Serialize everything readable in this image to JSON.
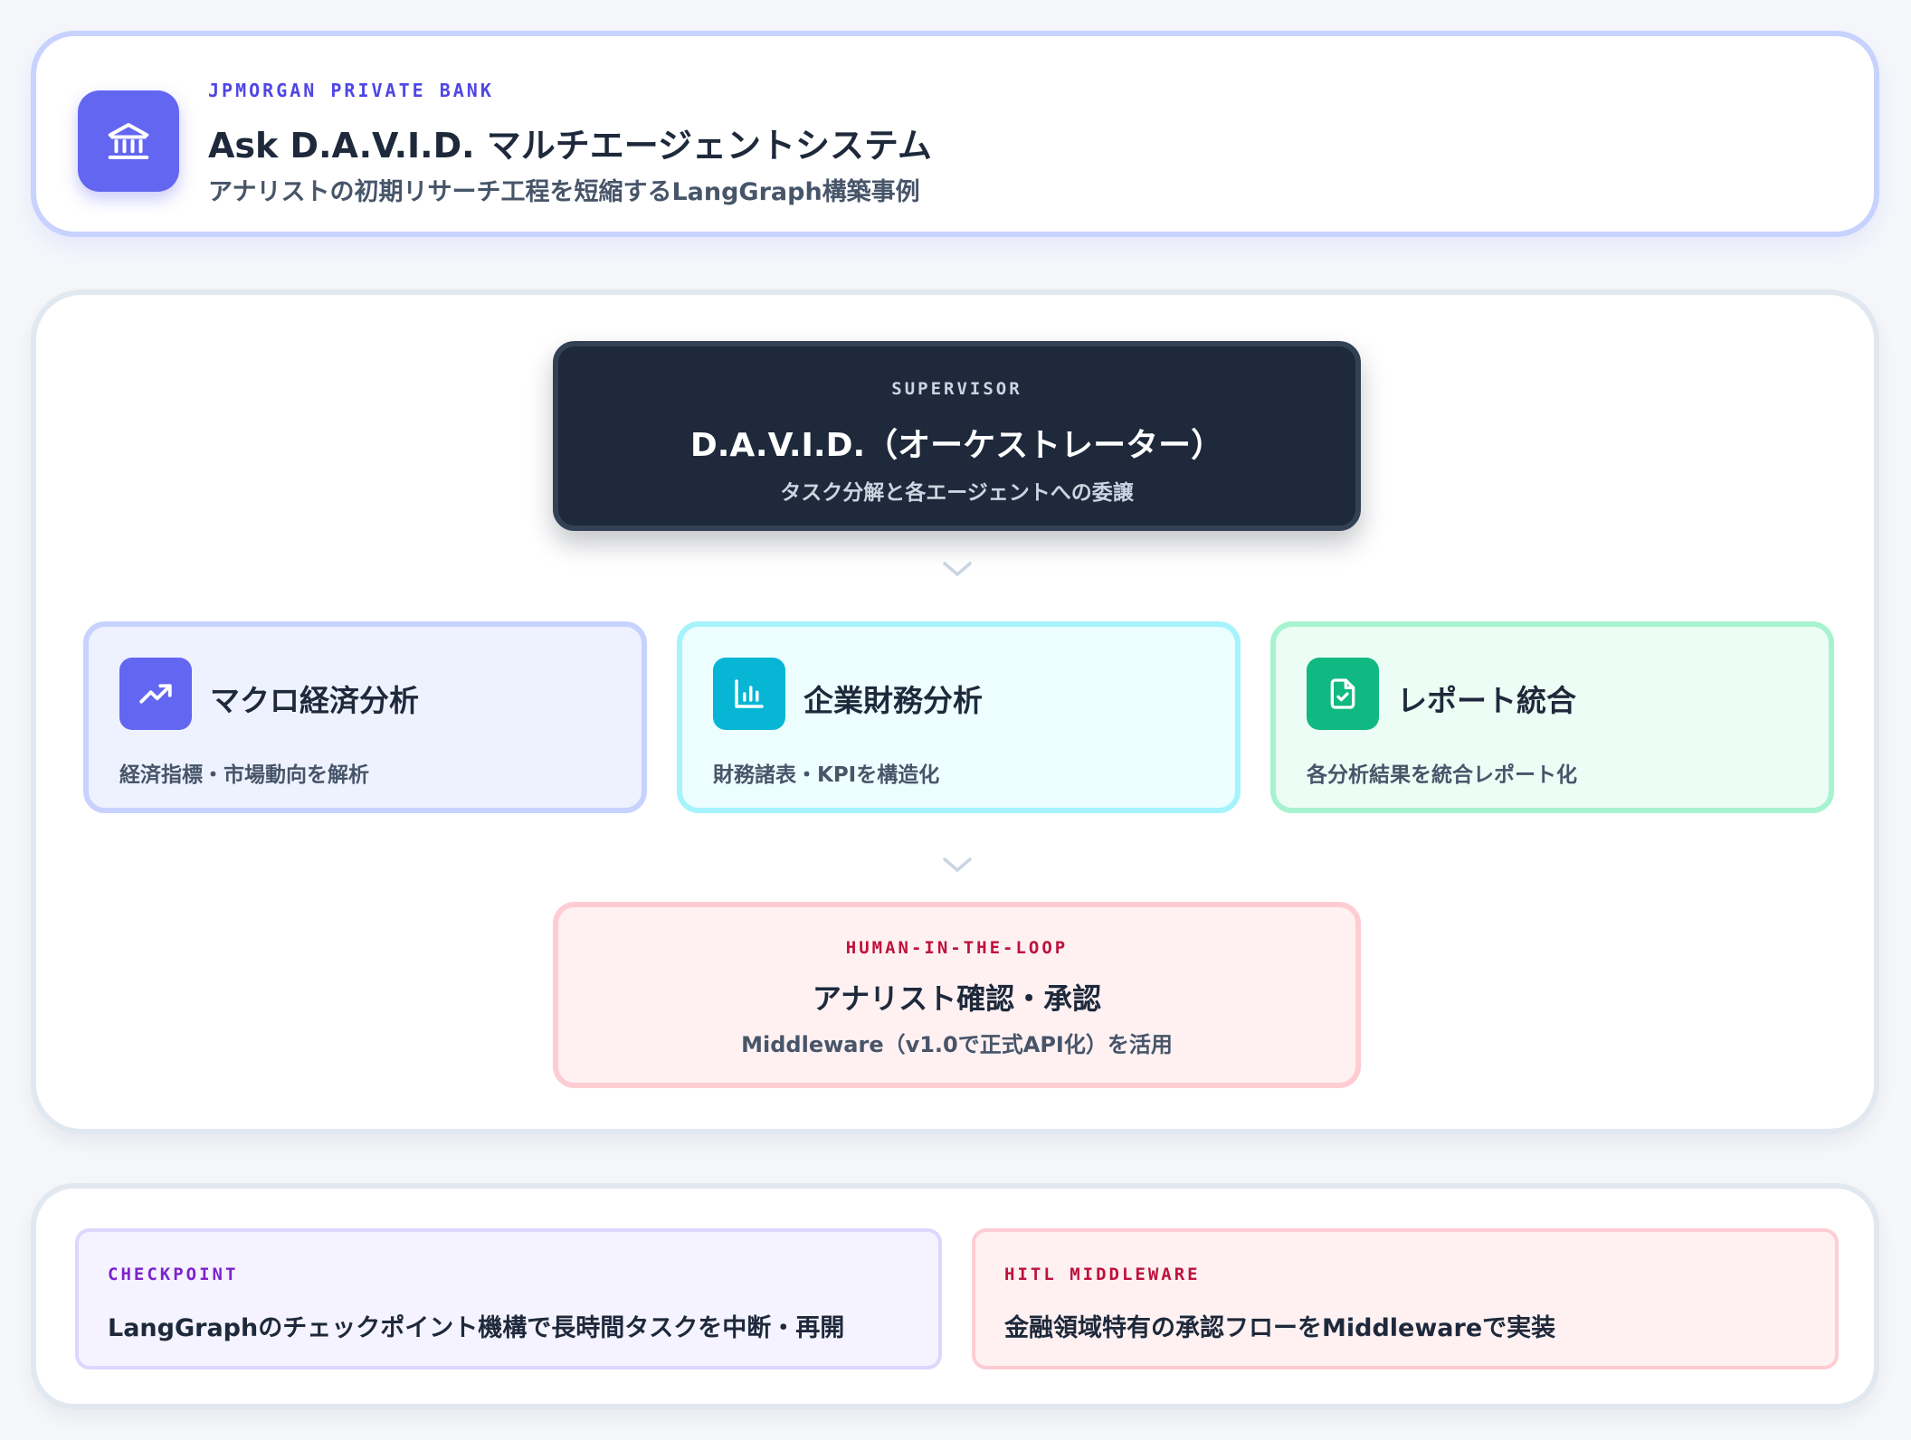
{
  "header": {
    "eyebrow": "JPMORGAN PRIVATE BANK",
    "title": "Ask D.A.V.I.D. マルチエージェントシステム",
    "subtitle": "アナリストの初期リサーチ工程を短縮するLangGraph構築事例",
    "logo_icon": "bank-icon",
    "accent": "#6366f1"
  },
  "supervisor": {
    "eyebrow": "SUPERVISOR",
    "title": "D.A.V.I.D.（オーケストレーター）",
    "subtitle": "タスク分解と各エージェントへの委譲"
  },
  "agents": [
    {
      "title": "マクロ経済分析",
      "description": "経済指標・市場動向を解析",
      "icon": "trending-up-icon",
      "color": "#6366f1"
    },
    {
      "title": "企業財務分析",
      "description": "財務諸表・KPIを構造化",
      "icon": "bar-chart-icon",
      "color": "#06b6d4"
    },
    {
      "title": "レポート統合",
      "description": "各分析結果を統合レポート化",
      "icon": "file-check-icon",
      "color": "#10b981"
    }
  ],
  "hitl": {
    "eyebrow": "HUMAN-IN-THE-LOOP",
    "title": "アナリスト確認・承認",
    "subtitle": "Middleware（v1.0で正式API化）を活用"
  },
  "features": [
    {
      "eyebrow": "CHECKPOINT",
      "text": "LangGraphのチェックポイント機構で長時間タスクを中断・再開"
    },
    {
      "eyebrow": "HITL MIDDLEWARE",
      "text": "金融領域特有の承認フローをMiddlewareで実装"
    }
  ]
}
